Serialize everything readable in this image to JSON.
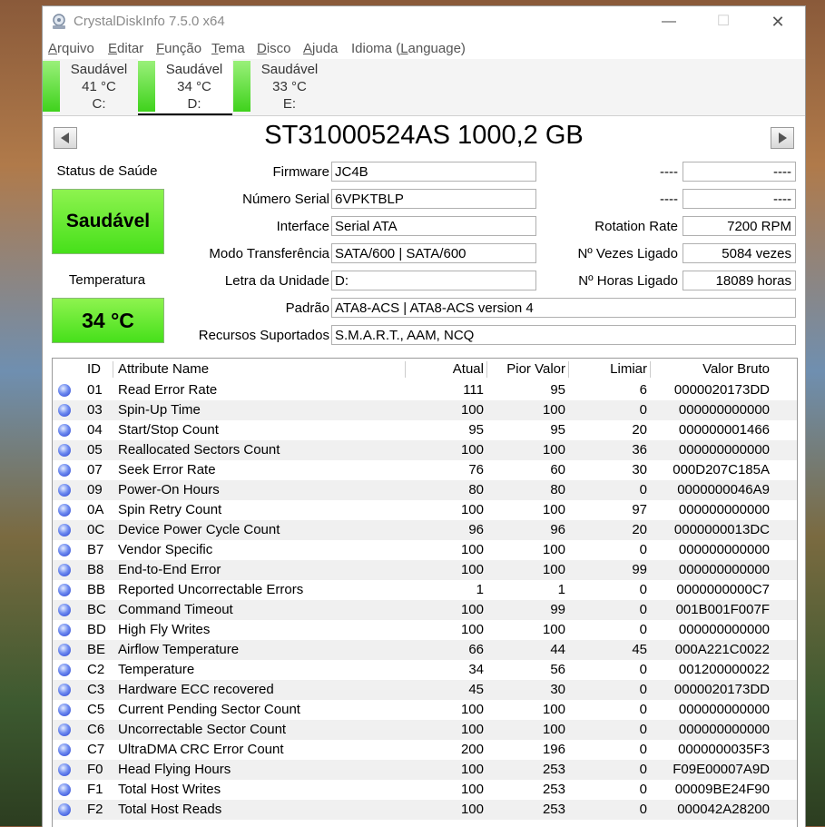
{
  "window": {
    "title": "CrystalDiskInfo 7.5.0 x64",
    "min": "—",
    "max": "☐",
    "close": "✕"
  },
  "menu": [
    {
      "u": "A",
      "rest": "rquivo"
    },
    {
      "u": "E",
      "rest": "ditar"
    },
    {
      "u": "F",
      "rest": "unção"
    },
    {
      "u": "T",
      "rest": "ema"
    },
    {
      "u": "D",
      "rest": "isco"
    },
    {
      "u": "A",
      "rest": "juda"
    },
    {
      "pre": "Idioma (",
      "u": "L",
      "rest": "anguage)"
    }
  ],
  "drives": [
    {
      "status": "Saudável",
      "temp": "41 °C",
      "letter": "C:"
    },
    {
      "status": "Saudável",
      "temp": "34 °C",
      "letter": "D:"
    },
    {
      "status": "Saudável",
      "temp": "33 °C",
      "letter": "E:"
    }
  ],
  "model": "ST31000524AS 1000,2 GB",
  "health": {
    "title": "Status de Saúde",
    "value": "Saudável",
    "color": "#46e01a"
  },
  "temperature": {
    "title": "Temperatura",
    "value": "34 °C"
  },
  "info": {
    "firmware_label": "Firmware",
    "firmware": "JC4B",
    "serial_label": "Número Serial",
    "serial": "6VPKTBLP",
    "interface_label": "Interface",
    "interface": "Serial ATA",
    "transfer_label": "Modo Transferência",
    "transfer": "SATA/600 | SATA/600",
    "letter_label": "Letra da Unidade",
    "letter": "D:",
    "standard_label": "Padrão",
    "standard": "ATA8-ACS | ATA8-ACS version 4",
    "features_label": "Recursos Suportados",
    "features": "S.M.A.R.T., AAM, NCQ",
    "r1_label": "----",
    "r1": "----",
    "r2_label": "----",
    "r2": "----",
    "rotation_label": "Rotation Rate",
    "rotation": "7200 RPM",
    "power_count_label": "Nº Vezes Ligado",
    "power_count": "5084 vezes",
    "power_hours_label": "Nº Horas Ligado",
    "power_hours": "18089 horas"
  },
  "smart": {
    "headers": [
      "ID",
      "Attribute Name",
      "Atual",
      "Pior Valor",
      "Limiar",
      "Valor Bruto"
    ],
    "rows": [
      [
        "01",
        "Read Error Rate",
        "111",
        "95",
        "6",
        "0000020173DD"
      ],
      [
        "03",
        "Spin-Up Time",
        "100",
        "100",
        "0",
        "000000000000"
      ],
      [
        "04",
        "Start/Stop Count",
        "95",
        "95",
        "20",
        "000000001466"
      ],
      [
        "05",
        "Reallocated Sectors Count",
        "100",
        "100",
        "36",
        "000000000000"
      ],
      [
        "07",
        "Seek Error Rate",
        "76",
        "60",
        "30",
        "000D207C185A"
      ],
      [
        "09",
        "Power-On Hours",
        "80",
        "80",
        "0",
        "0000000046A9"
      ],
      [
        "0A",
        "Spin Retry Count",
        "100",
        "100",
        "97",
        "000000000000"
      ],
      [
        "0C",
        "Device Power Cycle Count",
        "96",
        "96",
        "20",
        "0000000013DC"
      ],
      [
        "B7",
        "Vendor Specific",
        "100",
        "100",
        "0",
        "000000000000"
      ],
      [
        "B8",
        "End-to-End Error",
        "100",
        "100",
        "99",
        "000000000000"
      ],
      [
        "BB",
        "Reported Uncorrectable Errors",
        "1",
        "1",
        "0",
        "0000000000C7"
      ],
      [
        "BC",
        "Command Timeout",
        "100",
        "99",
        "0",
        "001B001F007F"
      ],
      [
        "BD",
        "High Fly Writes",
        "100",
        "100",
        "0",
        "000000000000"
      ],
      [
        "BE",
        "Airflow Temperature",
        "66",
        "44",
        "45",
        "000A221C0022"
      ],
      [
        "C2",
        "Temperature",
        "34",
        "56",
        "0",
        "001200000022"
      ],
      [
        "C3",
        "Hardware ECC recovered",
        "45",
        "30",
        "0",
        "0000020173DD"
      ],
      [
        "C5",
        "Current Pending Sector Count",
        "100",
        "100",
        "0",
        "000000000000"
      ],
      [
        "C6",
        "Uncorrectable Sector Count",
        "100",
        "100",
        "0",
        "000000000000"
      ],
      [
        "C7",
        "UltraDMA CRC Error Count",
        "200",
        "196",
        "0",
        "0000000035F3"
      ],
      [
        "F0",
        "Head Flying Hours",
        "100",
        "253",
        "0",
        "F09E00007A9D"
      ],
      [
        "F1",
        "Total Host Writes",
        "100",
        "253",
        "0",
        "00009BE24F90"
      ],
      [
        "F2",
        "Total Host Reads",
        "100",
        "253",
        "0",
        "000042A28200"
      ]
    ]
  }
}
